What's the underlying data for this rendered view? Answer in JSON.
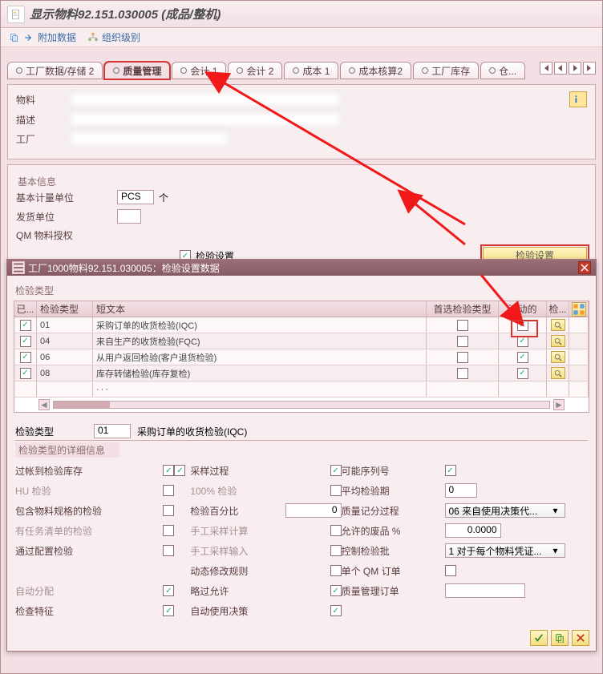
{
  "title": "显示物料92.151.030005 (成品/整机)",
  "toolbar": {
    "append": "附加数据",
    "orglevel": "组织级别"
  },
  "tabs": {
    "t0": "工厂数据/存储 2",
    "t1": "质量管理",
    "t2": "会计 1",
    "t3": "会计 2",
    "t4": "成本 1",
    "t5": "成本核算2",
    "t6": "工厂库存",
    "t7": "仓..."
  },
  "header": {
    "material_label": "物料",
    "desc_label": "描述",
    "plant_label": "工厂"
  },
  "basic": {
    "panel": "基本信息",
    "uom_label": "基本计量单位",
    "uom_value": "PCS",
    "uom_unit": "个",
    "issue_label": "发货单位",
    "qm_label": "QM 物料授权",
    "inspset_label": "检验设置",
    "inspect_btn": "检验设置"
  },
  "dialog": {
    "title": "工厂1000物料92.151.030005：检验设置数据",
    "insp_type_panel": "检验类型",
    "cols": {
      "c0": "已...",
      "c1": "检验类型",
      "c2": "短文本",
      "c3": "首选检验类型",
      "c4": "活动的",
      "c5": "检..."
    },
    "rows": [
      {
        "type": "01",
        "text": "采购订单的收货检验(IQC)",
        "pref": false,
        "active": true
      },
      {
        "type": "04",
        "text": "来自生产的收货检验(FQC)",
        "pref": false,
        "active": true
      },
      {
        "type": "06",
        "text": "从用户返回检验(客户退货检验)",
        "pref": false,
        "active": true
      },
      {
        "type": "08",
        "text": "库存转储检验(库存复检)",
        "pref": false,
        "active": true
      }
    ],
    "moredots": "···",
    "detail": {
      "type_label": "检验类型",
      "type_value": "01",
      "type_text": "采购订单的收货检验(IQC)",
      "panel": "检验类型的详细信息",
      "left": {
        "l0": "过帐到检验库存",
        "l1": "HU 检验",
        "l2": "包含物料规格的检验",
        "l3": "有任务清单的检验",
        "l4": "通过配置检验",
        "l5": "自动分配",
        "l6": "检查特征"
      },
      "mid": {
        "m0": "采样过程",
        "m1": "100% 检验",
        "m2": "检验百分比",
        "m3": "手工采样计算",
        "m4": "手工采样输入",
        "m5": "动态修改规则",
        "m6": "略过允许",
        "m7": "自动使用决策"
      },
      "right": {
        "r0": "可能序列号",
        "r1": "平均检验期",
        "r1v": "0",
        "r2": "质量记分过程",
        "r2v": "06 来自使用决策代...",
        "r3": "允许的废品 %",
        "r3v": "0.0000",
        "r4": "控制检验批",
        "r4v": "1 对于每个物料凭证...",
        "r5": "单个 QM 订单",
        "r6": "质量管理订单"
      },
      "pct": "0"
    }
  }
}
